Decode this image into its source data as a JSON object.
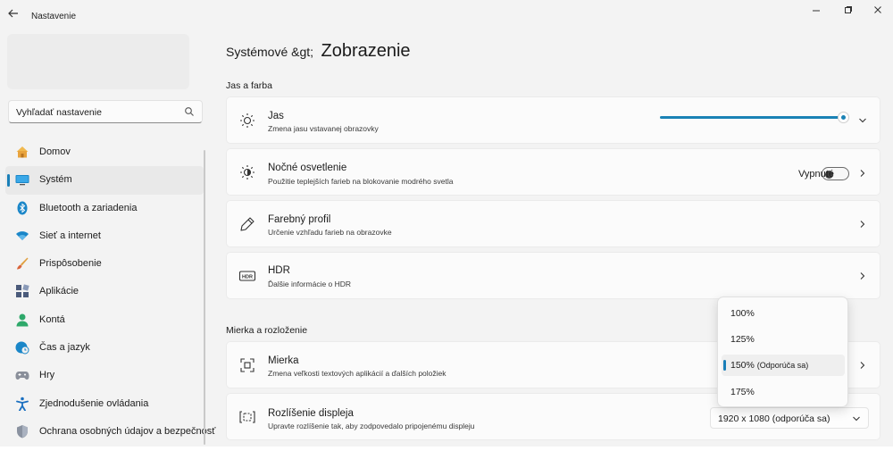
{
  "window": {
    "title": "Nastavenie",
    "back_icon": "back-arrow-icon",
    "controls": [
      "minimize-icon",
      "maximize-icon",
      "close-icon"
    ]
  },
  "sidebar": {
    "search": {
      "value": "Vyhľadať nastavenie"
    },
    "items": [
      {
        "label": "Domov",
        "icon": "home-icon",
        "color": "#e8a33d"
      },
      {
        "label": "Systém",
        "icon": "monitor-icon",
        "color": "#1a86c8",
        "active": true
      },
      {
        "label": "Bluetooth a zariadenia",
        "icon": "bluetooth-icon",
        "color": "#1a86c8"
      },
      {
        "label": "Sieť a internet",
        "icon": "wifi-icon",
        "color": "#1a86c8"
      },
      {
        "label": "Prispôsobenie",
        "icon": "brush-icon",
        "color": "#d97a3a"
      },
      {
        "label": "Aplikácie",
        "icon": "apps-icon",
        "color": "#4a5a7a"
      },
      {
        "label": "Kontá",
        "icon": "person-icon",
        "color": "#2ea86a"
      },
      {
        "label": "Čas a jazyk",
        "icon": "globe-clock-icon",
        "color": "#1a86c8"
      },
      {
        "label": "Hry",
        "icon": "gamepad-icon",
        "color": "#7a7a8a"
      },
      {
        "label": "Zjednodušenie ovládania",
        "icon": "accessibility-icon",
        "color": "#1a6fc0"
      },
      {
        "label": "Ochrana osobných údajov a bezpečnosť",
        "icon": "shield-icon",
        "color": "#7a8290"
      }
    ]
  },
  "main": {
    "breadcrumb_parent": "Systémové &gt;",
    "breadcrumb_current": "Zobrazenie",
    "sections": {
      "brightness_color": "Jas a farba",
      "scale_layout": "Mierka a rozloženie"
    },
    "cards": {
      "brightness": {
        "title": "Jas",
        "subtitle": "Zmena jasu vstavanej obrazovky",
        "value_percent": 100
      },
      "night_light": {
        "title": "Nočné osvetlenie",
        "subtitle": "Použitie teplejších farieb na blokovanie modrého svetla",
        "toggle_label": "Vypnuté"
      },
      "color_profile": {
        "title": "Farebný profil",
        "subtitle": "Určenie vzhľadu farieb na obrazovke"
      },
      "hdr": {
        "title": "HDR",
        "subtitle": "Ďalšie informácie o HDR",
        "icon_text": "HDR"
      },
      "scale": {
        "title": "Mierka",
        "subtitle": "Zmena veľkosti textových aplikácií a ďalších položiek"
      },
      "resolution": {
        "title": "Rozlíšenie displeja",
        "subtitle": "Upravte rozlíšenie tak, aby zodpovedalo pripojenému displeju",
        "value": "1920 x 1080 (odporúča sa)"
      }
    },
    "scale_dropdown": {
      "options": [
        "100%",
        "125%",
        "150%",
        "175%"
      ],
      "selected_value": "150%",
      "selected_note": "(Odporúča sa)"
    }
  },
  "colors": {
    "accent": "#1a82b5",
    "background": "#f3f3f3",
    "card": "#fbfbfb"
  }
}
